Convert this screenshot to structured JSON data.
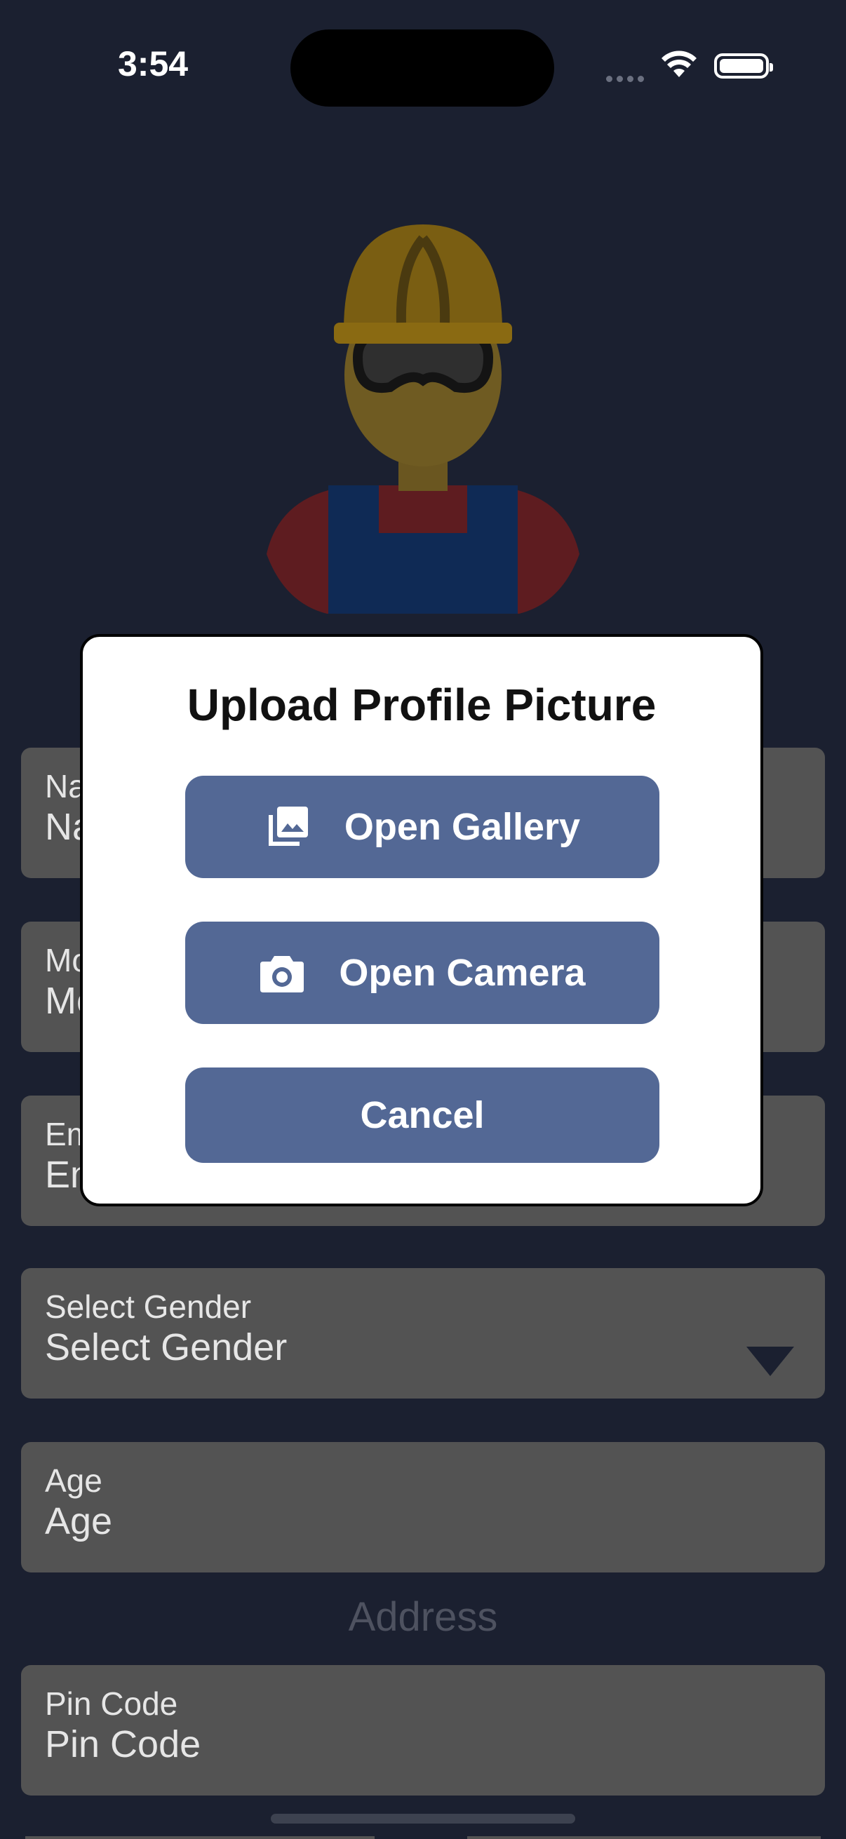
{
  "status_bar": {
    "time": "3:54"
  },
  "form": {
    "fields": [
      {
        "label": "Name",
        "value": "Name"
      },
      {
        "label": "Mobile",
        "value": "Mobile"
      },
      {
        "label": "Email",
        "value": "Email"
      },
      {
        "label": "Select Gender",
        "value": "Select Gender"
      },
      {
        "label": "Age",
        "value": "Age"
      }
    ],
    "address_title": "Address",
    "address_fields": [
      {
        "label": "Pin Code",
        "value": "Pin Code"
      }
    ]
  },
  "dialog": {
    "title": "Upload Profile Picture",
    "gallery_label": "Open Gallery",
    "camera_label": "Open Camera",
    "cancel_label": "Cancel"
  },
  "colors": {
    "background": "#1b2030",
    "field": "#535353",
    "button": "#536895",
    "dialog": "#ffffff"
  },
  "icons": [
    "wifi-icon",
    "battery-icon",
    "gallery-icon",
    "camera-icon",
    "chevron-down-icon",
    "worker-avatar"
  ]
}
